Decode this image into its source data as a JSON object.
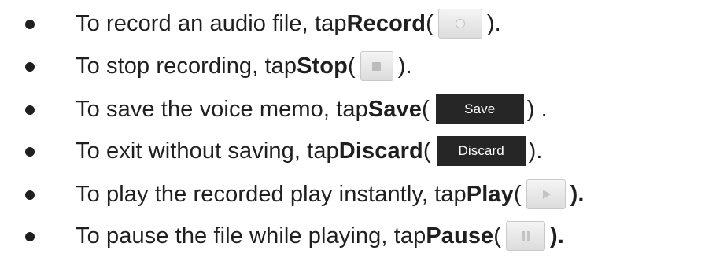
{
  "items": [
    {
      "before": "To record an audio file, tap ",
      "bold": "Record",
      "open": " (",
      "close": ").",
      "icon": "record-icon"
    },
    {
      "before": "To stop recording, tap ",
      "bold": "Stop",
      "open": " (",
      "close": ").",
      "icon": "stop-icon"
    },
    {
      "before": "To save the voice memo, tap ",
      "bold": "Save",
      "open": " (",
      "close": ") .",
      "button_label": "Save"
    },
    {
      "before": "To exit without saving, tap ",
      "bold": "Discard",
      "open": " (",
      "close": ").",
      "button_label": "Discard"
    },
    {
      "before": "To play the recorded play instantly, tap ",
      "bold": "Play",
      "open": " (",
      "close": ").",
      "icon": "play-icon"
    },
    {
      "before": "To pause the file while playing, tap ",
      "bold": "Pause",
      "open": " (",
      "close": ").",
      "icon": "pause-icon"
    }
  ]
}
